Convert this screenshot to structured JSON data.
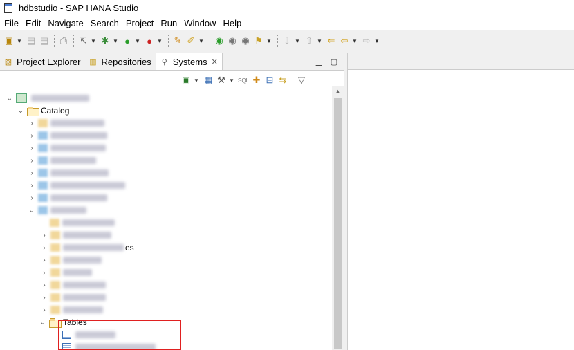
{
  "window": {
    "title": "hdbstudio - SAP HANA Studio"
  },
  "menu": [
    "File",
    "Edit",
    "Navigate",
    "Search",
    "Project",
    "Run",
    "Window",
    "Help"
  ],
  "tabs": [
    {
      "label": "Project Explorer",
      "icon": "project-explorer-icon"
    },
    {
      "label": "Repositories",
      "icon": "repositories-icon"
    },
    {
      "label": "Systems",
      "icon": "systems-icon",
      "active": true
    }
  ],
  "tree": {
    "catalog_label": "Catalog",
    "partial_label": "es",
    "tables_label": "Tables"
  },
  "colors": {
    "highlight": "#e02020",
    "folder": "#f5d58c",
    "table_icon": "#3b6fb5"
  }
}
